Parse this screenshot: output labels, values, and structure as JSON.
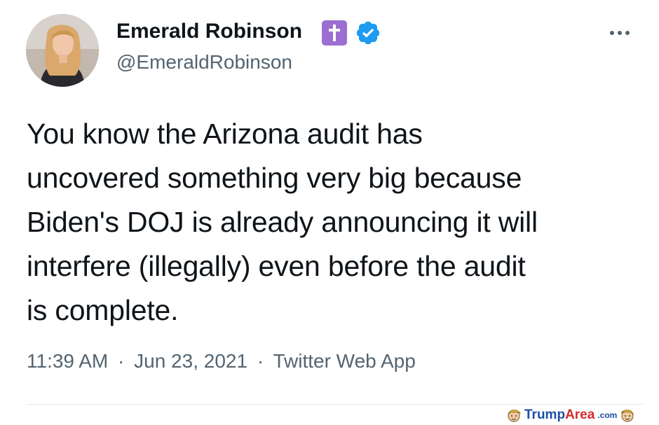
{
  "tweet": {
    "author": {
      "display_name": "Emerald Robinson",
      "handle": "@EmeraldRobinson",
      "badges": [
        "latin-cross-icon",
        "verified-checkmark-icon"
      ],
      "badge_colors": {
        "cross_bg": "#9b6fd1",
        "verified": "#1d9bf0"
      }
    },
    "text_lines": [
      "You know the Arizona audit has",
      "uncovered something very big because",
      "Biden's DOJ is already announcing it will",
      "interfere (illegally) even before the audit",
      "is complete."
    ],
    "meta": {
      "time": "11:39 AM",
      "separator": "·",
      "date": "Jun 23, 2021",
      "source": "Twitter Web App"
    },
    "more_icon": "more-horizontal-icon"
  },
  "watermark": {
    "part1": "Trump",
    "part2": "Area",
    "domain": ".com",
    "colors": {
      "primary": "#1d4fa3",
      "accent": "#d62b2b"
    }
  }
}
